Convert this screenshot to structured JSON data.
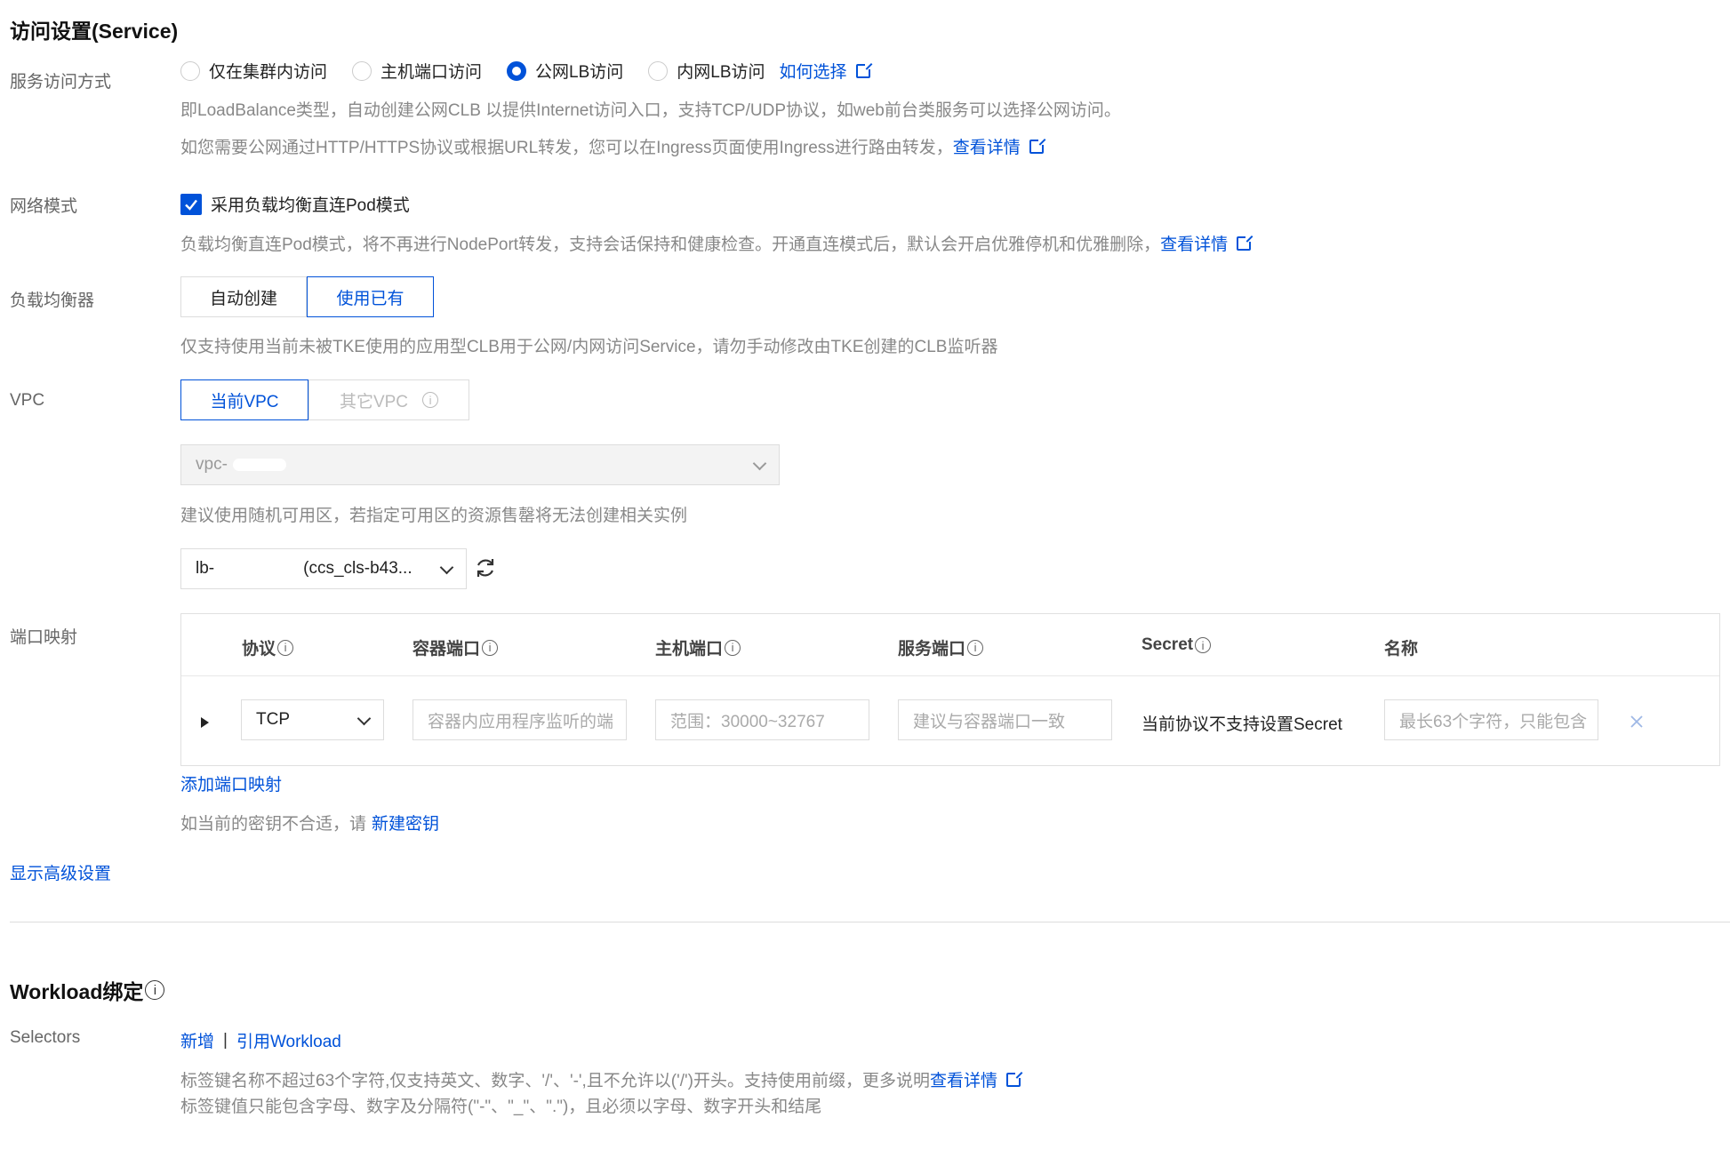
{
  "section_access": {
    "title": "访问设置(Service)",
    "service_access": {
      "label": "服务访问方式",
      "options": [
        "仅在集群内访问",
        "主机端口访问",
        "公网LB访问",
        "内网LB访问"
      ],
      "selected": "公网LB访问",
      "how_link": "如何选择",
      "desc1": "即LoadBalance类型，自动创建公网CLB 以提供Internet访问入口，支持TCP/UDP协议，如web前台类服务可以选择公网访问。",
      "desc2": "如您需要公网通过HTTP/HTTPS协议或根据URL转发，您可以在Ingress页面使用Ingress进行路由转发，",
      "desc2_link": "查看详情"
    },
    "network_mode": {
      "label": "网络模式",
      "checkbox_label": "采用负载均衡直连Pod模式",
      "checked": true,
      "desc": "负载均衡直连Pod模式，将不再进行NodePort转发，支持会话保持和健康检查。开通直连模式后，默认会开启优雅停机和优雅删除，",
      "desc_link": "查看详情"
    },
    "load_balancer": {
      "label": "负载均衡器",
      "options": [
        "自动创建",
        "使用已有"
      ],
      "selected": "使用已有",
      "desc": "仅支持使用当前未被TKE使用的应用型CLB用于公网/内网访问Service，请勿手动修改由TKE创建的CLB监听器"
    },
    "vpc": {
      "label": "VPC",
      "options": [
        "当前VPC",
        "其它VPC"
      ],
      "selected": "当前VPC",
      "vpc_select_value": "vpc-",
      "desc": "建议使用随机可用区，若指定可用区的资源售罄将无法创建相关实例",
      "lb_select_value": "lb-",
      "lb_select_suffix": "(ccs_cls-b43..."
    },
    "port_mapping": {
      "label": "端口映射",
      "columns": [
        "协议",
        "容器端口",
        "主机端口",
        "服务端口",
        "Secret",
        "名称"
      ],
      "row": {
        "protocol": "TCP",
        "container_port_placeholder": "容器内应用程序监听的端",
        "host_port_placeholder": "范围：30000~32767",
        "service_port_placeholder": "建议与容器端口一致",
        "secret_text": "当前协议不支持设置Secret",
        "name_placeholder": "最长63个字符，只能包含"
      },
      "add_link": "添加端口映射",
      "secret_hint": "如当前的密钥不合适，请",
      "new_secret_link": "新建密钥"
    },
    "advanced_link": "显示高级设置"
  },
  "section_workload": {
    "title": "Workload绑定",
    "selectors_label": "Selectors",
    "add_link": "新增",
    "separator": "|",
    "ref_link": "引用Workload",
    "desc1": "标签键名称不超过63个字符,仅支持英文、数字、'/'、'-',且不允许以('/')开头。支持使用前缀，更多说明",
    "desc1_link": "查看详情",
    "desc2": "标签键值只能包含字母、数字及分隔符(\"-\"、\"_\"、\".\")，且必须以字母、数字开头和结尾"
  },
  "colors": {
    "accent": "#0052d9",
    "label": "#666666",
    "hint": "#888888"
  }
}
